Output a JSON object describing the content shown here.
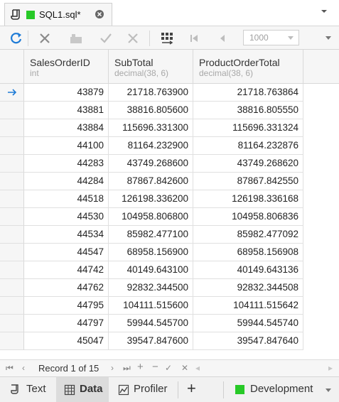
{
  "tab": {
    "title": "SQL1.sql*",
    "status_color": "#27c927"
  },
  "toolbar": {
    "limit_value": "1000"
  },
  "grid": {
    "columns": [
      {
        "name": "SalesOrderID",
        "type": "int"
      },
      {
        "name": "SubTotal",
        "type": "decimal(38, 6)"
      },
      {
        "name": "ProductOrderTotal",
        "type": "decimal(38, 6)"
      }
    ],
    "rows": [
      [
        "43879",
        "21718.763900",
        "21718.763864"
      ],
      [
        "43881",
        "38816.805600",
        "38816.805550"
      ],
      [
        "43884",
        "115696.331300",
        "115696.331324"
      ],
      [
        "44100",
        "81164.232900",
        "81164.232876"
      ],
      [
        "44283",
        "43749.268600",
        "43749.268620"
      ],
      [
        "44284",
        "87867.842600",
        "87867.842550"
      ],
      [
        "44518",
        "126198.336200",
        "126198.336168"
      ],
      [
        "44530",
        "104958.806800",
        "104958.806836"
      ],
      [
        "44534",
        "85982.477100",
        "85982.477092"
      ],
      [
        "44547",
        "68958.156900",
        "68958.156908"
      ],
      [
        "44742",
        "40149.643100",
        "40149.643136"
      ],
      [
        "44762",
        "92832.344500",
        "92832.344508"
      ],
      [
        "44795",
        "104111.515600",
        "104111.515642"
      ],
      [
        "44797",
        "59944.545700",
        "59944.545740"
      ],
      [
        "45047",
        "39547.847600",
        "39547.847640"
      ]
    ]
  },
  "navigator": {
    "record_text": "Record 1 of 15"
  },
  "bottom": {
    "tabs": [
      "Text",
      "Data",
      "Profiler"
    ],
    "active_tab": "Data",
    "environment": "Development",
    "environment_color": "#27c927"
  },
  "colors": {
    "accent": "#1e7bd6",
    "header_bg": "#f6f6f6"
  }
}
